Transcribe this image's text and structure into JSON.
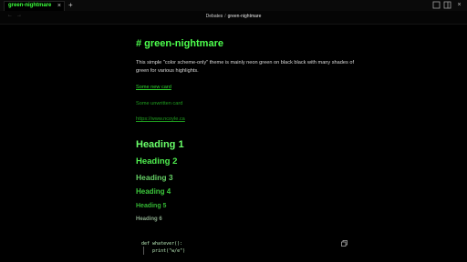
{
  "tabs": [
    {
      "label": "green-nightmare",
      "active": true
    }
  ],
  "tab_close_icon": "close-icon",
  "new_tab_icon": "plus-icon",
  "window_controls": [
    "minimize-icon",
    "split-view-icon",
    "close-icon"
  ],
  "nav": {
    "back_icon": "arrow-left-icon",
    "forward_icon": "arrow-right-icon",
    "breadcrumb": {
      "folder": "Debates",
      "separator": "/",
      "current": "green-nightmare"
    }
  },
  "document": {
    "title": "# green-nightmare",
    "intro": "This simple \"color scheme-only\" theme is mainly neon green on black black with many shades of green for various highlights.",
    "links": {
      "existing": "Some new card",
      "unwritten": "Some unwritten card",
      "url": "https://www.ncoyle.ca"
    },
    "headings": {
      "h1": "Heading 1",
      "h2": "Heading 2",
      "h3": "Heading 3",
      "h4": "Heading 4",
      "h5": "Heading 5",
      "h6": "Heading 6"
    },
    "code": {
      "line1": "def whatever():",
      "line2": "    print(\"w/e\")"
    },
    "copy_icon": "copy-icon"
  },
  "colors": {
    "background": "#000000",
    "accent": "#4dff4d"
  }
}
